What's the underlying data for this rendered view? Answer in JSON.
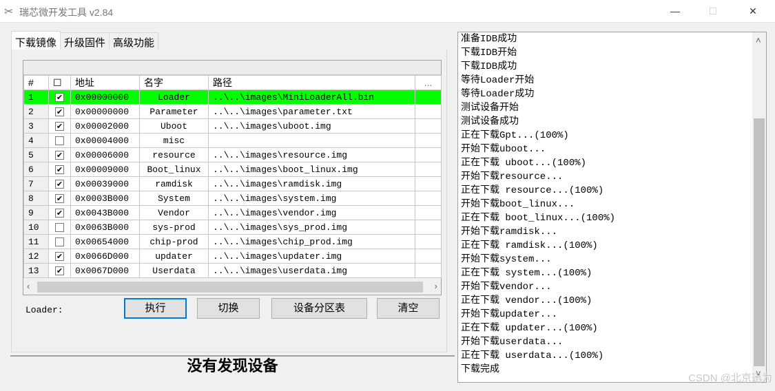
{
  "window": {
    "title": "瑞芯微开发工具 v2.84",
    "minimize": "—",
    "maximize": "☐",
    "close": "✕"
  },
  "tabs": [
    "下载镜像",
    "升级固件",
    "高级功能"
  ],
  "table": {
    "headers": [
      "#",
      "☐",
      "地址",
      "名字",
      "路径",
      "..."
    ],
    "rows": [
      {
        "n": "1",
        "checked": true,
        "addr": "0x00000000",
        "name": "Loader",
        "path": "..\\..\\images\\MiniLoaderAll.bin",
        "selected": true
      },
      {
        "n": "2",
        "checked": true,
        "addr": "0x00000000",
        "name": "Parameter",
        "path": "..\\..\\images\\parameter.txt"
      },
      {
        "n": "3",
        "checked": true,
        "addr": "0x00002000",
        "name": "Uboot",
        "path": "..\\..\\images\\uboot.img"
      },
      {
        "n": "4",
        "checked": false,
        "addr": "0x00004000",
        "name": "misc",
        "path": ""
      },
      {
        "n": "5",
        "checked": true,
        "addr": "0x00006000",
        "name": "resource",
        "path": "..\\..\\images\\resource.img"
      },
      {
        "n": "6",
        "checked": true,
        "addr": "0x00009000",
        "name": "Boot_linux",
        "path": "..\\..\\images\\boot_linux.img"
      },
      {
        "n": "7",
        "checked": true,
        "addr": "0x00039000",
        "name": "ramdisk",
        "path": "..\\..\\images\\ramdisk.img"
      },
      {
        "n": "8",
        "checked": true,
        "addr": "0x0003B000",
        "name": "System",
        "path": "..\\..\\images\\system.img"
      },
      {
        "n": "9",
        "checked": true,
        "addr": "0x0043B000",
        "name": "Vendor",
        "path": "..\\..\\images\\vendor.img"
      },
      {
        "n": "10",
        "checked": false,
        "addr": "0x0063B000",
        "name": "sys-prod",
        "path": "..\\..\\images\\sys_prod.img"
      },
      {
        "n": "11",
        "checked": false,
        "addr": "0x00654000",
        "name": "chip-prod",
        "path": "..\\..\\images\\chip_prod.img"
      },
      {
        "n": "12",
        "checked": true,
        "addr": "0x0066D000",
        "name": "updater",
        "path": "..\\..\\images\\updater.img"
      },
      {
        "n": "13",
        "checked": true,
        "addr": "0x0067D000",
        "name": "Userdata",
        "path": "..\\..\\images\\userdata.img"
      }
    ]
  },
  "loader_label": "Loader:",
  "buttons": {
    "run": "执行",
    "switch": "切换",
    "partition": "设备分区表",
    "clear": "清空"
  },
  "status": "没有发现设备",
  "log": [
    "准备IDB成功",
    "下载IDB开始",
    "下载IDB成功",
    "等待Loader开始",
    "等待Loader成功",
    "测试设备开始",
    "测试设备成功",
    "正在下载Gpt...(100%)",
    "开始下载uboot...",
    "正在下载 uboot...(100%)",
    "开始下载resource...",
    "正在下载 resource...(100%)",
    "开始下载boot_linux...",
    "正在下载 boot_linux...(100%)",
    "开始下载ramdisk...",
    "正在下载 ramdisk...(100%)",
    "开始下载system...",
    "正在下载 system...(100%)",
    "开始下载vendor...",
    "正在下载 vendor...(100%)",
    "开始下载updater...",
    "正在下载 updater...(100%)",
    "开始下载userdata...",
    "正在下载 userdata...(100%)",
    "下载完成"
  ],
  "watermark": "CSDN @北京迅为"
}
